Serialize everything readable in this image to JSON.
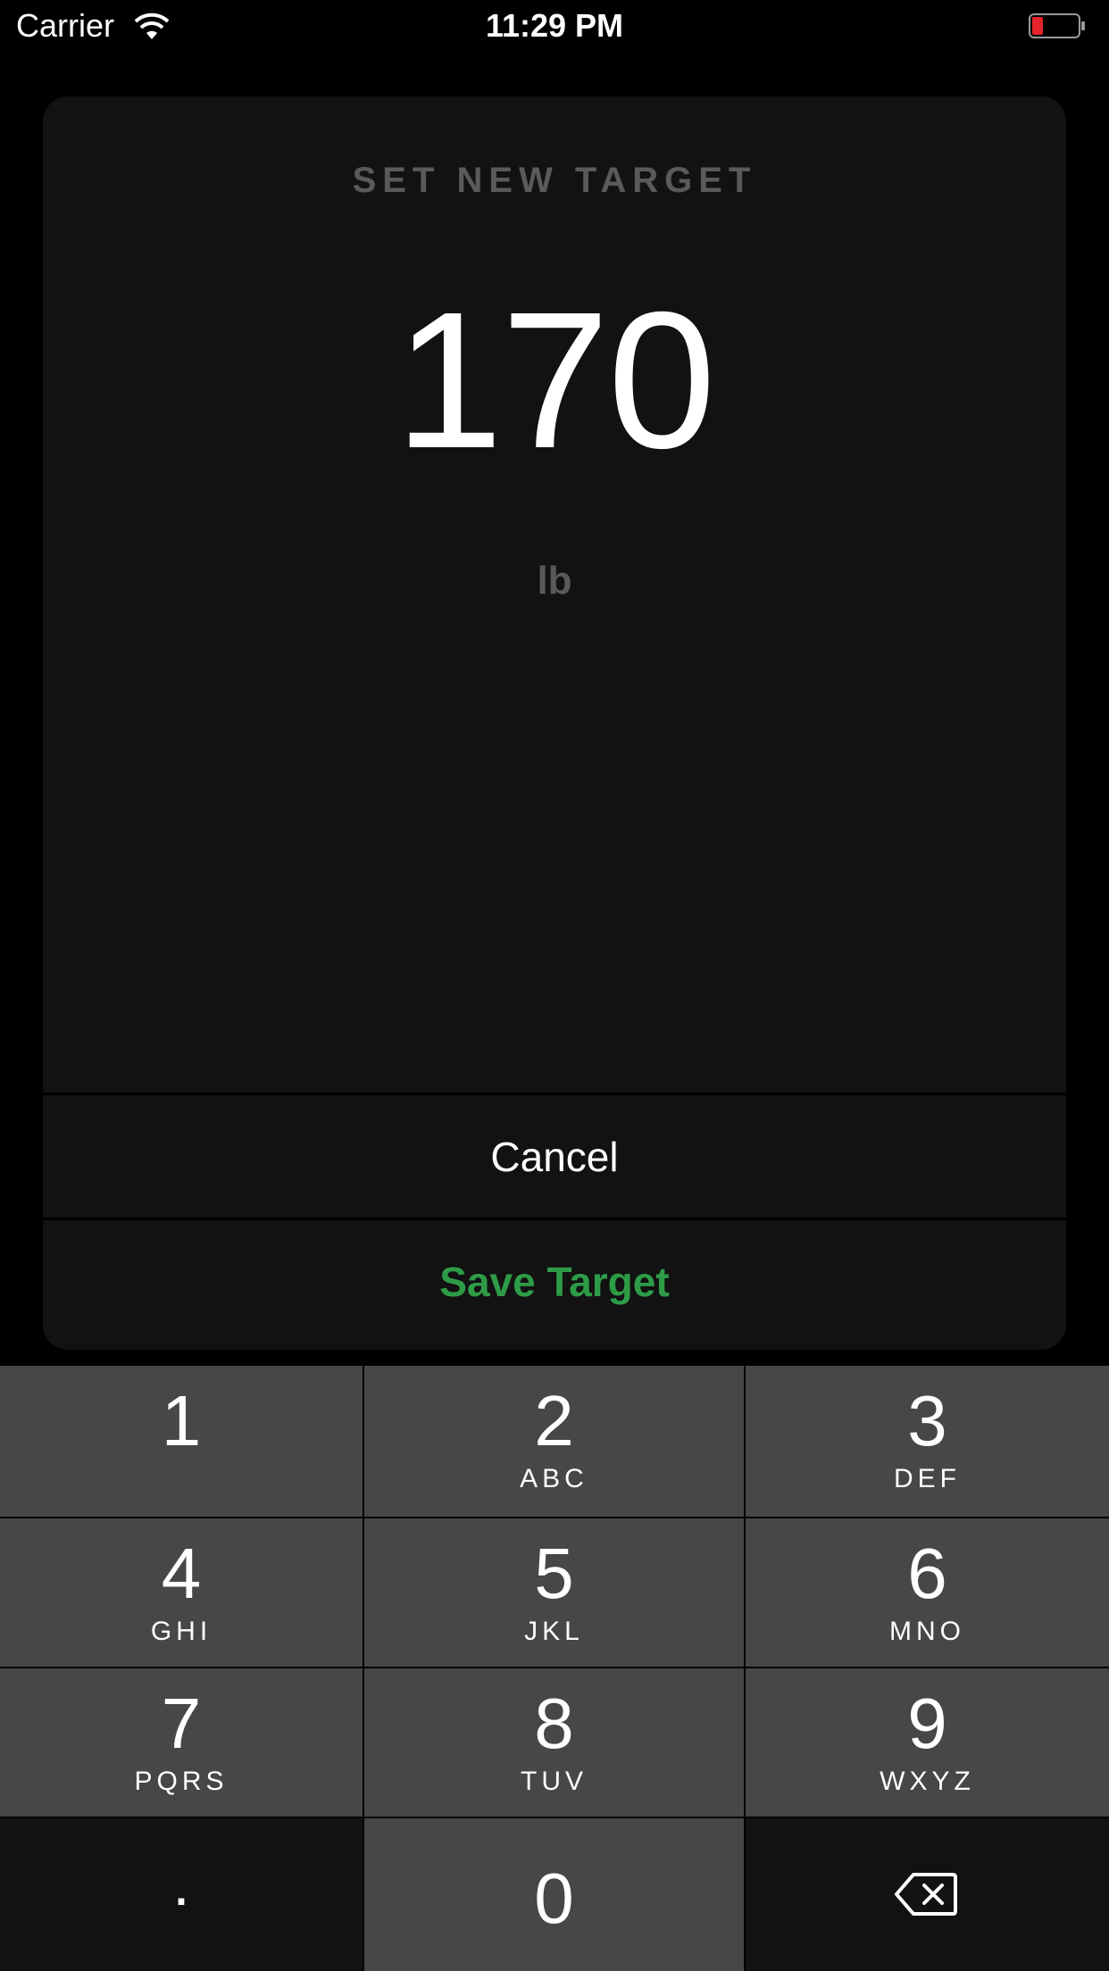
{
  "status_bar": {
    "carrier": "Carrier",
    "time": "11:29 PM",
    "battery_color": "#e5232a"
  },
  "card": {
    "title": "SET NEW TARGET",
    "value": "170",
    "unit": "lb",
    "cancel_label": "Cancel",
    "save_label": "Save Target",
    "save_color": "#2e9c47"
  },
  "keypad": {
    "keys": [
      {
        "digit": "1",
        "letters": ""
      },
      {
        "digit": "2",
        "letters": "ABC"
      },
      {
        "digit": "3",
        "letters": "DEF"
      },
      {
        "digit": "4",
        "letters": "GHI"
      },
      {
        "digit": "5",
        "letters": "JKL"
      },
      {
        "digit": "6",
        "letters": "MNO"
      },
      {
        "digit": "7",
        "letters": "PQRS"
      },
      {
        "digit": "8",
        "letters": "TUV"
      },
      {
        "digit": "9",
        "letters": "WXYZ"
      }
    ],
    "decimal": ".",
    "zero": "0",
    "backspace_icon": "backspace-icon"
  }
}
